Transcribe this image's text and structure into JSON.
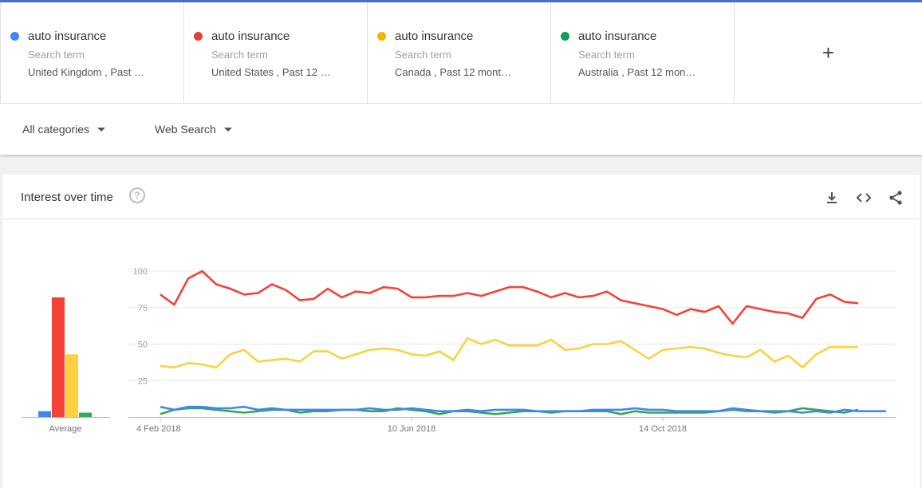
{
  "terms": [
    {
      "name": "auto insurance",
      "type": "Search term",
      "geo": "United Kingdom , Past …",
      "color": "#4285f4"
    },
    {
      "name": "auto insurance",
      "type": "Search term",
      "geo": "United States , Past 12 …",
      "color": "#db4437"
    },
    {
      "name": "auto insurance",
      "type": "Search term",
      "geo": "Canada , Past 12 mont…",
      "color": "#f4b400"
    },
    {
      "name": "auto insurance",
      "type": "Search term",
      "geo": "Australia , Past 12 mon…",
      "color": "#0f9d58"
    }
  ],
  "add_label": "+",
  "filters": {
    "category": "All categories",
    "search_type": "Web Search"
  },
  "card": {
    "title": "Interest over time",
    "help": "?"
  },
  "chart_data": {
    "type": "line",
    "ylim": [
      0,
      100
    ],
    "y_ticks": [
      25,
      50,
      75,
      100
    ],
    "x_tick_labels": [
      "4 Feb 2018",
      "10 Jun 2018",
      "14 Oct 2018"
    ],
    "x_tick_indices": [
      0,
      18,
      36
    ],
    "average_label": "Average",
    "averages": [
      4,
      82,
      43,
      3
    ],
    "series": [
      {
        "color": "#4285f4",
        "values": [
          7,
          5,
          7,
          7,
          6,
          6,
          7,
          5,
          6,
          5,
          5,
          5,
          5,
          5,
          5,
          6,
          5,
          5,
          6,
          5,
          4,
          4,
          5,
          4,
          5,
          5,
          5,
          4,
          4,
          4,
          4,
          5,
          5,
          5,
          6,
          5,
          5,
          4,
          4,
          4,
          4,
          6,
          5,
          4,
          3,
          4,
          3,
          4,
          3,
          5,
          4,
          4,
          4
        ]
      },
      {
        "color": "#f44336",
        "values": [
          84,
          77,
          95,
          100,
          91,
          88,
          84,
          85,
          91,
          87,
          80,
          81,
          88,
          82,
          86,
          85,
          89,
          88,
          82,
          82,
          83,
          83,
          85,
          83,
          86,
          89,
          89,
          86,
          82,
          85,
          82,
          83,
          86,
          80,
          78,
          76,
          74,
          70,
          74,
          72,
          76,
          64,
          76,
          74,
          72,
          71,
          68,
          81,
          84,
          79,
          78
        ]
      },
      {
        "color": "#fdd13f",
        "values": [
          35,
          34,
          37,
          36,
          34,
          43,
          46,
          38,
          39,
          40,
          38,
          45,
          45,
          40,
          43,
          46,
          47,
          46,
          43,
          42,
          45,
          39,
          54,
          50,
          53,
          49,
          49,
          49,
          53,
          46,
          47,
          50,
          50,
          52,
          46,
          40,
          46,
          47,
          48,
          47,
          44,
          42,
          41,
          46,
          38,
          42,
          34,
          43,
          48,
          48,
          48
        ]
      },
      {
        "color": "#34a853",
        "values": [
          2,
          5,
          6,
          6,
          5,
          4,
          3,
          4,
          5,
          5,
          3,
          4,
          4,
          5,
          5,
          4,
          4,
          6,
          5,
          4,
          2,
          4,
          4,
          3,
          2,
          3,
          4,
          4,
          3,
          4,
          4,
          4,
          4,
          2,
          4,
          3,
          3,
          3,
          3,
          3,
          4,
          5,
          4,
          4,
          4,
          4,
          6,
          5,
          4,
          3,
          5
        ]
      }
    ]
  }
}
